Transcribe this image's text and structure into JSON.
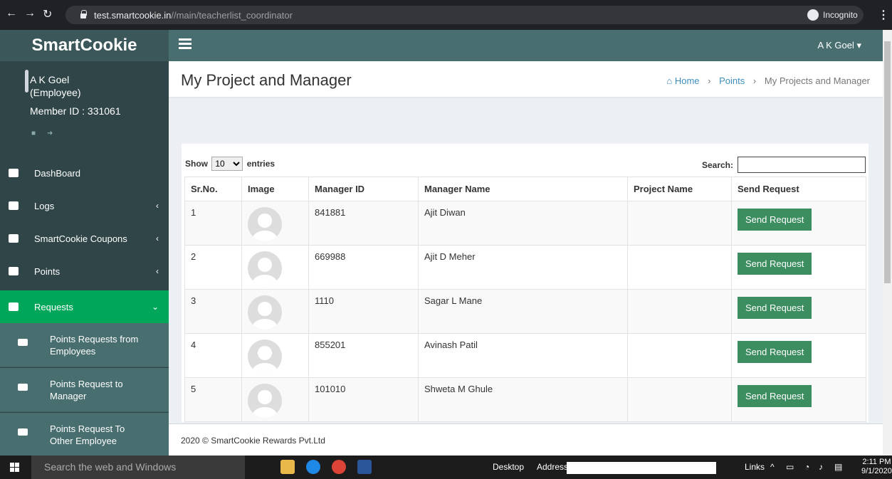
{
  "browser": {
    "url_host": "test.smartcookie.in",
    "url_path": "//main/teacherlist_coordinator",
    "incognito_label": "Incognito"
  },
  "app": {
    "logo": "SmartCookie",
    "user_menu": "A K Goel ▾"
  },
  "profile": {
    "name": "A K Goel",
    "role": "(Employee)",
    "member_id": "Member ID : 331061"
  },
  "sidebar": {
    "items": [
      {
        "label": "DashBoard",
        "icon": "dashboard-icon"
      },
      {
        "label": "Logs",
        "icon": "list-icon",
        "caret": "‹"
      },
      {
        "label": "SmartCookie Coupons",
        "icon": "file-icon",
        "caret": "‹"
      },
      {
        "label": "Points",
        "icon": "briefcase-icon",
        "caret": "‹"
      },
      {
        "label": "Requests",
        "icon": "users-icon",
        "caret": "⌄"
      }
    ],
    "sub_items": [
      {
        "label": "Points Requests from Employees",
        "icon": "users-icon"
      },
      {
        "label": "Points Request to Manager",
        "icon": "users-icon"
      },
      {
        "label": "Points Request To Other Employee",
        "icon": "users-icon"
      }
    ]
  },
  "page": {
    "title": "My Project and Manager",
    "breadcrumb": [
      "Home",
      "Points",
      "My Projects and Manager"
    ],
    "breadcrumb_sep": "›"
  },
  "table": {
    "show_label": "Show",
    "entries_value": "10",
    "entries_label": "entries",
    "search_label": "Search:",
    "headers": [
      "Sr.No.",
      "Image",
      "Manager ID",
      "Manager Name",
      "Project Name",
      "Send Request"
    ],
    "rows": [
      {
        "sr": "1",
        "manager_id": "841881",
        "manager_name": "Ajit Diwan",
        "project_name": "",
        "button": "Send Request"
      },
      {
        "sr": "2",
        "manager_id": "669988",
        "manager_name": "Ajit D Meher",
        "project_name": "",
        "button": "Send Request"
      },
      {
        "sr": "3",
        "manager_id": "1110",
        "manager_name": "Sagar L Mane",
        "project_name": "",
        "button": "Send Request"
      },
      {
        "sr": "4",
        "manager_id": "855201",
        "manager_name": "Avinash Patil",
        "project_name": "",
        "button": "Send Request"
      },
      {
        "sr": "5",
        "manager_id": "101010",
        "manager_name": "Shweta M Ghule",
        "project_name": "",
        "button": "Send Request"
      }
    ]
  },
  "footer": {
    "text": "2020 © SmartCookie Rewards Pvt.Ltd"
  },
  "taskbar": {
    "search_placeholder": "Search the web and Windows",
    "desktop_label": "Desktop",
    "address_label": "Address",
    "links_label": "Links",
    "time": "2:11 PM",
    "date": "9/1/2020"
  },
  "colors": {
    "sidebar": "#2f4547",
    "topbar": "#486e70",
    "active": "#00a65a",
    "button": "#3c8d5f",
    "link": "#3c8dbc"
  }
}
